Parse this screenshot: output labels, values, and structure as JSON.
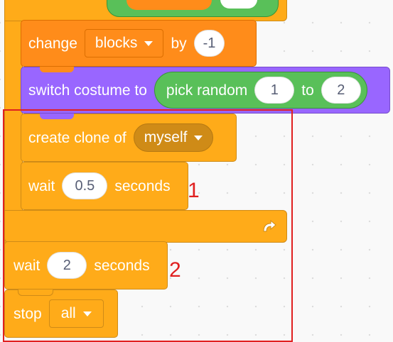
{
  "blocks": {
    "change": {
      "label": "change",
      "dropdown": "blocks",
      "by_label": "by",
      "value": "-1"
    },
    "switch_costume": {
      "label": "switch costume to",
      "reporter_label": "pick random",
      "from": "1",
      "to_label": "to",
      "to": "2"
    },
    "create_clone": {
      "label": "create clone of",
      "dropdown": "myself"
    },
    "wait_inner": {
      "label": "wait",
      "value": "0.5",
      "unit": "seconds"
    },
    "wait_outer": {
      "label": "wait",
      "value": "2",
      "unit": "seconds"
    },
    "stop": {
      "label": "stop",
      "dropdown": "all"
    }
  },
  "annotations": {
    "first": "1",
    "second": "2"
  },
  "icons": {
    "loop_arrow": "loop-arrow-icon",
    "dropdown_caret": "caret-down-icon"
  },
  "colors": {
    "control": "#ffab19",
    "variables": "#ff8c1a",
    "looks": "#9966ff",
    "operators": "#59c059",
    "highlight_box": "#e02020"
  }
}
